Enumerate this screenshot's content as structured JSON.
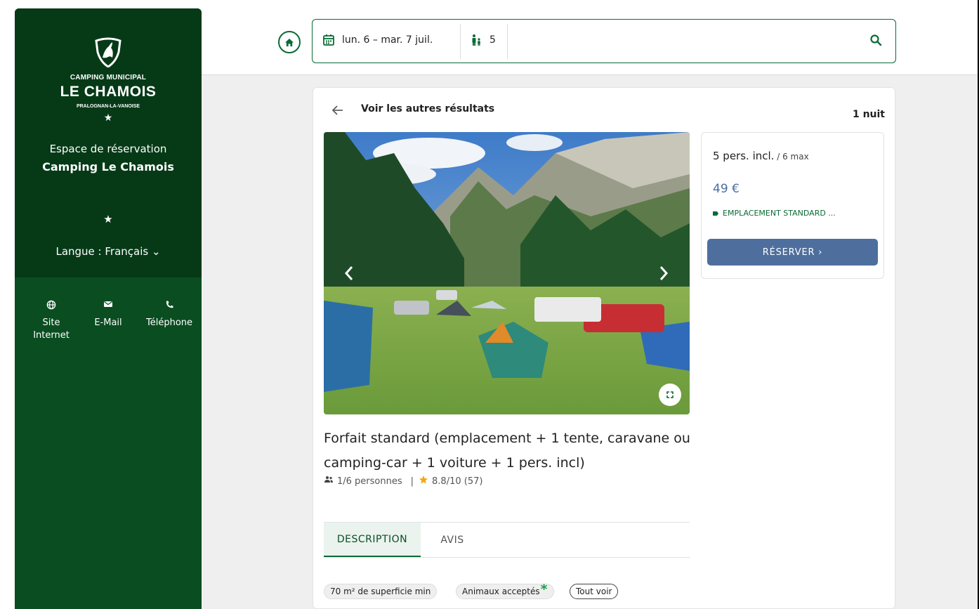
{
  "sidebar": {
    "brand_line1": "CAMPING MUNICIPAL",
    "brand_line2": "LE CHAMOIS",
    "brand_line3": "PRALOGNAN-LA-VANOISE",
    "star": "★",
    "space_label": "Espace de réservation",
    "space_name": "Camping Le Chamois",
    "language": "Langue : Français ⌄",
    "contacts": [
      {
        "label_1": "Site",
        "label_2": "Internet",
        "icon": "globe-icon"
      },
      {
        "label_1": "E-Mail",
        "label_2": "",
        "icon": "mail-icon"
      },
      {
        "label_1": "Téléphone",
        "label_2": "",
        "icon": "phone-icon"
      }
    ]
  },
  "search": {
    "dates": "lun. 6 – mar. 7 juil.",
    "guests": "5"
  },
  "result": {
    "back_label": "Voir les autres résultats",
    "nights": "1 nuit",
    "title": "Forfait standard (emplacement + 1 tente, caravane ou camping-car + 1 voiture + 1 pers. incl)",
    "capacity": "1/6 personnes",
    "separator": "|",
    "rating": "8.8/10 (57)"
  },
  "tabs": [
    {
      "label": "DESCRIPTION",
      "active": true
    },
    {
      "label": "AVIS",
      "active": false
    }
  ],
  "chips": [
    {
      "label": "70 m² de superficie min"
    },
    {
      "label": "Animaux acceptés",
      "mark": "*"
    },
    {
      "label": "Tout voir"
    }
  ],
  "booking": {
    "persons": "5 pers. incl.",
    "persons_max": " / 6 max",
    "price": "49 €",
    "pitch_type": "EMPLACEMENT STANDARD ...",
    "reserve_label": "RÉSERVER ›"
  },
  "colors": {
    "sidebar_dark": "#063a17",
    "sidebar": "#0a4d21",
    "accent_green": "#0a6b35",
    "button_blue": "#4e6f9d",
    "price_blue": "#4a6fa1",
    "star_yellow": "#f2a71b"
  }
}
